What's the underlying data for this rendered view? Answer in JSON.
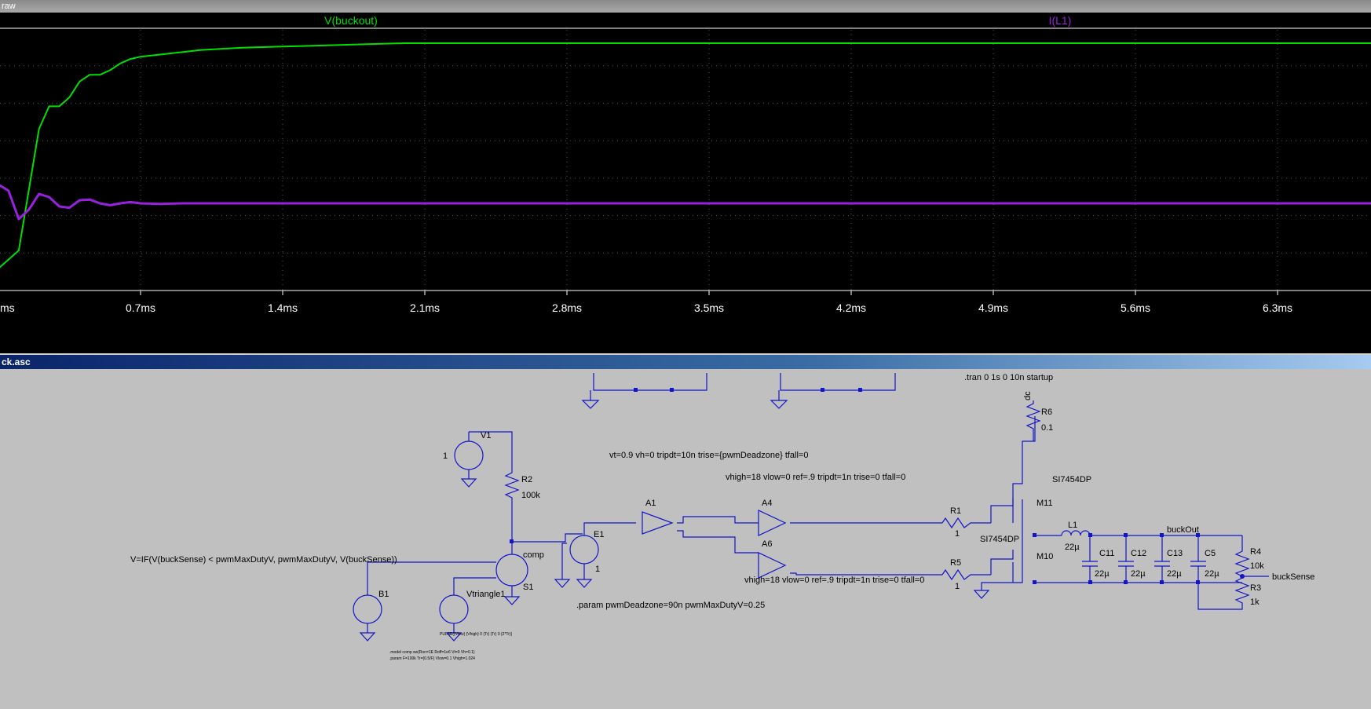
{
  "waveform_window": {
    "title": "raw",
    "traces": [
      {
        "name": "V(buckout)",
        "color": "#00e000"
      },
      {
        "name": "I(L1)",
        "color": "#9a20e0"
      }
    ],
    "x_ticks": [
      "ms",
      "0.7ms",
      "1.4ms",
      "2.1ms",
      "2.8ms",
      "3.5ms",
      "4.2ms",
      "4.9ms",
      "5.6ms",
      "6.3ms"
    ]
  },
  "chart_data": {
    "type": "line",
    "title": "",
    "xlabel": "",
    "ylabel": "",
    "xlim": [
      0.0,
      7.0
    ],
    "x_unit": "ms",
    "series": [
      {
        "name": "V(buckout)",
        "color": "#00e000",
        "x": [
          0.0,
          0.1,
          0.15,
          0.2,
          0.25,
          0.3,
          0.35,
          0.4,
          0.45,
          0.5,
          0.55,
          0.6,
          0.65,
          0.7,
          0.8,
          0.9,
          1.0,
          1.2,
          1.4,
          1.6,
          1.8,
          2.0,
          3.0,
          4.0,
          5.0,
          6.0,
          7.0
        ],
        "y": [
          0.0,
          0.08,
          0.35,
          0.62,
          0.72,
          0.72,
          0.76,
          0.83,
          0.86,
          0.86,
          0.88,
          0.91,
          0.93,
          0.94,
          0.95,
          0.96,
          0.97,
          0.98,
          0.985,
          0.99,
          0.995,
          1.0,
          1.0,
          1.0,
          1.0,
          1.0,
          1.0
        ]
      },
      {
        "name": "I(L1)",
        "color": "#9a20e0",
        "x": [
          0.0,
          0.05,
          0.1,
          0.15,
          0.2,
          0.25,
          0.3,
          0.35,
          0.4,
          0.45,
          0.5,
          0.55,
          0.6,
          0.65,
          0.7,
          0.8,
          0.9,
          1.0,
          1.5,
          2.0,
          3.0,
          4.0,
          5.0,
          6.0,
          7.0
        ],
        "y": [
          0.3,
          0.2,
          -0.25,
          -0.1,
          0.15,
          0.1,
          -0.05,
          -0.07,
          0.05,
          0.06,
          0.0,
          -0.03,
          0.0,
          0.02,
          0.0,
          -0.01,
          0.0,
          0.0,
          0.0,
          0.0,
          0.0,
          0.0,
          0.0,
          0.0,
          0.0
        ]
      }
    ]
  },
  "schematic_window": {
    "title": "ck.asc",
    "directives": {
      "tran": ".tran 0 1s 0 10n startup",
      "schmitt": "vt=0.9 vh=0 tripdt=10n trise={pwmDeadzone} tfall=0",
      "inv1": "vhigh=18 vlow=0 ref=.9 tripdt=1n trise=0 tfall=0",
      "inv2": "vhigh=18 vlow=0 ref=.9 tripdt=1n trise=0 tfall=0",
      "param": ".param pwmDeadzone=90n pwmMaxDutyV=0.25",
      "bsource": "V=IF(V(buckSense) < pwmMaxDutyV, pwmMaxDutyV, V(buckSense))",
      "pulse": "PULSE({Vlow} {Vhigh} 0 {Tr} {Tr} 0 {2*Tr})",
      "model": ".model comp sw(Ron=1E Roff=1e6 Vt=0 Vh=0.1)",
      "param2": ".param F=100k Tr={0.5/F} Vlow=0.1 Vhigh=1.024"
    },
    "labels": {
      "v1": "V1",
      "v1_val": "1",
      "r2": "R2",
      "r2_val": "100k",
      "e1": "E1",
      "e1_val": "1",
      "comp": "comp",
      "s1": "S1",
      "b1": "B1",
      "vtri": "Vtriangle1",
      "a1": "A1",
      "a4": "A4",
      "a6": "A6",
      "r1": "R1",
      "r1_val": "1",
      "r5": "R5",
      "r5_val": "1",
      "r6": "R6",
      "r6_val": "0.1",
      "dc": "dc",
      "m11": "M11",
      "m11_model": "SI7454DP",
      "m10": "M10",
      "m10_model": "SI7454DP",
      "l1": "L1",
      "l1_val": "22µ",
      "c11": "C11",
      "c12": "C12",
      "c13": "C13",
      "c5": "C5",
      "cap_val": "22µ",
      "buckout": "buckOut",
      "r4": "R4",
      "r4_val": "10k",
      "r3": "R3",
      "r3_val": "1k",
      "bucksense": "buckSense"
    }
  }
}
